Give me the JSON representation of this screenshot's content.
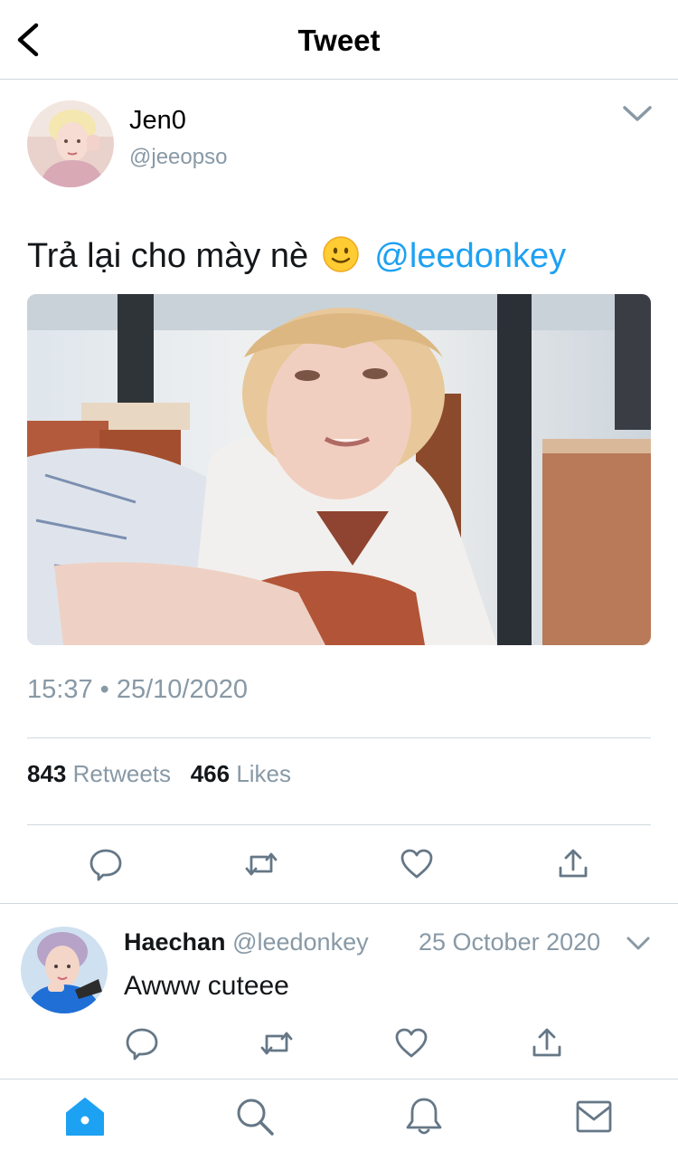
{
  "header": {
    "title": "Tweet",
    "back_icon": "chevron-left-icon"
  },
  "tweet": {
    "author_name": "Jen0",
    "author_handle": "@jeeopso",
    "text": "Trả lại cho mày nè",
    "emoji": "slightly-smiling-face",
    "mention": "@leedonkey",
    "timestamp": "15:37 • 25/10/2020",
    "retweets_count": "843",
    "retweets_label": "Retweets",
    "likes_count": "466",
    "likes_label": "Likes"
  },
  "reply": {
    "author_name": "Haechan",
    "author_handle": "@leedonkey",
    "date": "25 October 2020",
    "text": "Awww cuteee"
  },
  "tabbar": {
    "items": [
      "home",
      "search",
      "notifications",
      "messages"
    ],
    "active": "home"
  },
  "colors": {
    "accent": "#1da1f2",
    "secondary_text": "#8899a6",
    "divider": "#cfd9de",
    "icon": "#657786"
  }
}
